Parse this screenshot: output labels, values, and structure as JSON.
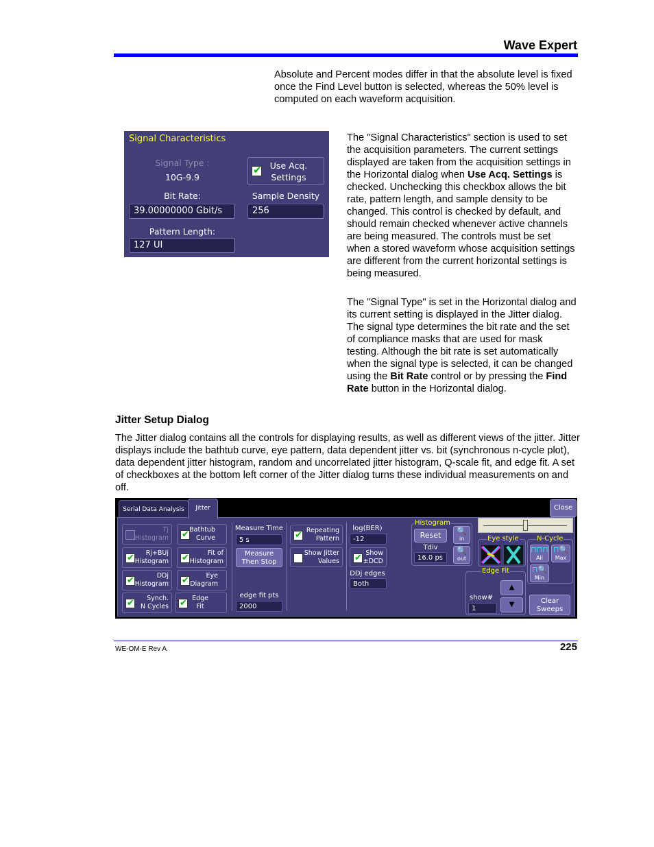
{
  "header": {
    "title": "Wave Expert"
  },
  "paragraphs": {
    "p1": "Absolute and Percent modes differ in that the absolute level is fixed once the Find Level button is selected, whereas the 50% level is computed on each waveform acquisition.",
    "p2_a": "The \"Signal Characteristics\" section is used to set the acquisition parameters. The current settings displayed are taken from the acquisition settings in the Horizontal dialog when ",
    "p2_b": "Use Acq. Settings",
    "p2_c": " is checked. Unchecking this checkbox allows the bit rate, pattern length, and sample density to be changed. This control is checked by default, and should remain checked whenever active channels are being measured. The controls must be set when a stored waveform whose acquisition settings are different from the current horizontal settings is being measured.",
    "p3_a": "The \"Signal Type\" is set in the Horizontal dialog and its current setting is displayed in the Jitter dialog. The signal type determines the bit rate and the set of compliance masks that are used for mask testing. Although the bit rate is set automatically when the signal type is selected, it can be changed using the ",
    "p3_b": "Bit Rate",
    "p3_c": " control or by pressing the ",
    "p3_d": "Find Rate",
    "p3_e": " button in the Horizontal dialog.",
    "heading": "Jitter Setup Dialog",
    "p4": "The Jitter dialog contains all the controls for displaying results, as well as different views of the jitter. Jitter displays include the bathtub curve, eye pattern, data dependent jitter vs. bit (synchronous n-cycle plot), data dependent jitter histogram, random and uncorrelated jitter histogram, Q-scale fit, and edge fit. A set of checkboxes at the bottom left corner of the Jitter dialog turns these individual measurements on and off."
  },
  "signal_characteristics": {
    "title": "Signal Characteristics",
    "signal_type_label": "Signal Type :",
    "signal_type_value": "10G-9.9",
    "use_acq_label_1": "Use Acq.",
    "use_acq_label_2": "Settings",
    "use_acq_checked": true,
    "bit_rate_label": "Bit Rate:",
    "bit_rate_value": "39.00000000 Gbit/s",
    "sample_density_label": "Sample Density",
    "sample_density_value": "256",
    "pattern_length_label": "Pattern Length:",
    "pattern_length_value": "127 UI"
  },
  "jitter_dialog": {
    "tabs": [
      {
        "label": "Serial Data Analysis"
      },
      {
        "label": "Jitter"
      }
    ],
    "close_label": "Close",
    "checkboxes": [
      {
        "l1": "Tj",
        "l2": "Histogram",
        "checked": false,
        "disabled": true
      },
      {
        "l1": "Bathtub",
        "l2": "Curve",
        "checked": true
      },
      {
        "l1": "Rj+BUj",
        "l2": "Histogram",
        "checked": true
      },
      {
        "l1": "Fit of",
        "l2": "Histogram",
        "checked": true
      },
      {
        "l1": "DDj",
        "l2": "Histogram",
        "checked": true
      },
      {
        "l1": "Eye",
        "l2": "Diagram",
        "checked": true
      },
      {
        "l1": "Synch.",
        "l2": "N Cycles",
        "checked": true
      },
      {
        "l1": "Edge",
        "l2": "Fit",
        "checked": true
      },
      {
        "l1": "Repeating",
        "l2": "Pattern",
        "checked": true
      },
      {
        "l1": "Show Jitter",
        "l2": "Values",
        "checked": false
      },
      {
        "l1": "Show",
        "l2": "±DCD",
        "checked": true
      }
    ],
    "measure_time_label": "Measure Time",
    "measure_time_value": "5 s",
    "measure_then_stop_1": "Measure",
    "measure_then_stop_2": "Then Stop",
    "edge_fit_pts_label": "edge fit pts",
    "edge_fit_pts_value": "2000",
    "log_ber_label": "log(BER)",
    "log_ber_value": "-12",
    "ddj_edges_label": "DDj edges",
    "ddj_edges_value": "Both",
    "histogram_group": "Histogram",
    "reset_label": "Reset",
    "zoom_in_label": "in",
    "zoom_out_label": "out",
    "tdiv_label": "Tdiv",
    "tdiv_value": "16.0 ps",
    "eye_style_group": "Eye style",
    "ncycle_group": "N-Cycle",
    "ncycle_all": "All",
    "ncycle_max": "Max",
    "ncycle_min": "Min",
    "edge_fit_group": "Edge Fit",
    "show_num_label": "show#",
    "show_num_value": "1",
    "clear_sweeps_1": "Clear",
    "clear_sweeps_2": "Sweeps",
    "slider_position": 0.5
  },
  "footer": {
    "doc_id": "WE-OM-E Rev A",
    "page_number": "225"
  }
}
